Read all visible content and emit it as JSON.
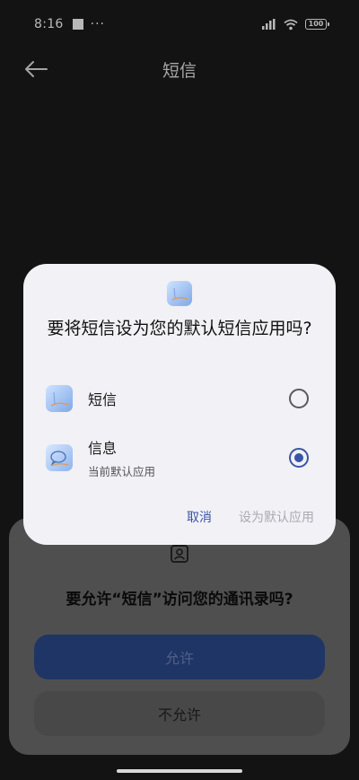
{
  "status_bar": {
    "time": "8:16",
    "dots": "···",
    "battery": "100"
  },
  "header": {
    "title": "短信",
    "back_icon": "arrow-left-icon"
  },
  "dialog": {
    "app_icon": "sms-app-icon",
    "title": "要将短信设为您的默认短信应用吗?",
    "options": [
      {
        "label": "短信",
        "sublabel": "",
        "icon": "sms-app-icon",
        "selected": false
      },
      {
        "label": "信息",
        "sublabel": "当前默认应用",
        "icon": "messages-app-icon",
        "selected": true
      }
    ],
    "cancel_label": "取消",
    "set_default_label": "设为默认应用"
  },
  "permission_sheet": {
    "icon": "contacts-icon",
    "question": "要允许“短信”访问您的通讯录吗?",
    "allow_label": "允许",
    "deny_label": "不允许"
  },
  "colors": {
    "accent": "#3a55a4",
    "dialog_bg": "#f1f1f6",
    "sheet_bg": "#6e6e70",
    "allow_bg": "#2b4a8d"
  }
}
